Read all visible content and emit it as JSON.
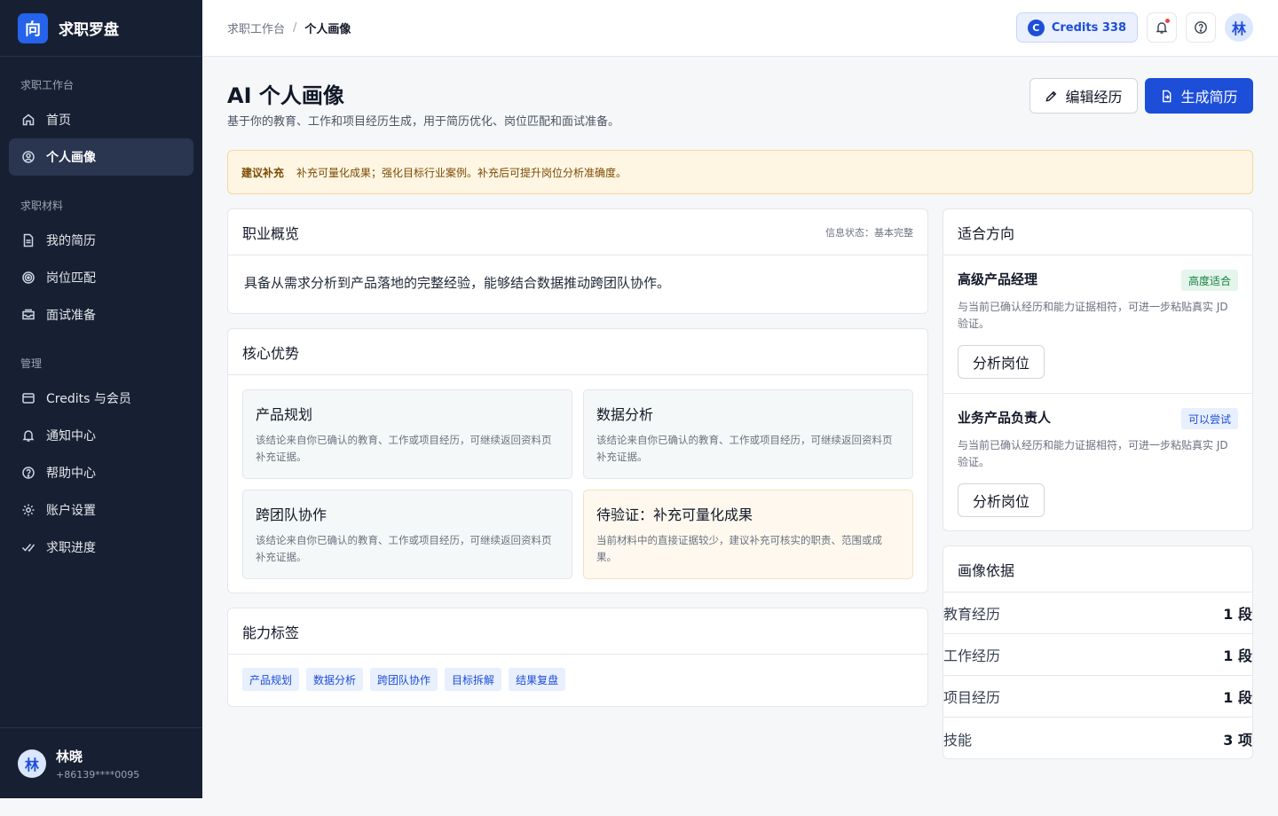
{
  "brand": {
    "logo_char": "向",
    "name": "求职罗盘"
  },
  "sidebar": {
    "sections": [
      {
        "title": "求职工作台",
        "items": [
          {
            "label": "首页",
            "icon": "home-icon"
          },
          {
            "label": "个人画像",
            "icon": "user-circle-icon",
            "active": true
          }
        ]
      },
      {
        "title": "求职材料",
        "items": [
          {
            "label": "我的简历",
            "icon": "document-icon"
          },
          {
            "label": "岗位匹配",
            "icon": "target-icon"
          },
          {
            "label": "面试准备",
            "icon": "inbox-icon"
          }
        ]
      },
      {
        "title": "管理",
        "items": [
          {
            "label": "Credits 与会员",
            "icon": "card-icon"
          },
          {
            "label": "通知中心",
            "icon": "bell-icon"
          },
          {
            "label": "帮助中心",
            "icon": "help-icon"
          },
          {
            "label": "账户设置",
            "icon": "gear-icon"
          },
          {
            "label": "求职进度",
            "icon": "check-double-icon"
          }
        ]
      }
    ]
  },
  "user": {
    "avatar_char": "林",
    "name": "林晓",
    "phone": "+86139****0095"
  },
  "header": {
    "breadcrumb": {
      "parent": "求职工作台",
      "separator": "/",
      "current": "个人画像"
    },
    "credits": {
      "icon_char": "C",
      "label": "Credits 338"
    },
    "avatar_char": "林"
  },
  "page": {
    "title": "AI 个人画像",
    "subtitle": "基于你的教育、工作和项目经历生成，用于简历优化、岗位匹配和面试准备。",
    "edit_button": "编辑经历",
    "generate_button": "生成简历"
  },
  "alert": {
    "tag": "建议补充",
    "text": "补充可量化成果；强化目标行业案例。补充后可提升岗位分析准确度。"
  },
  "overview": {
    "title": "职业概览",
    "meta": "信息状态：基本完整",
    "text": "具备从需求分析到产品落地的完整经验，能够结合数据推动跨团队协作。"
  },
  "strengths": {
    "title": "核心优势",
    "items": [
      {
        "title": "产品规划",
        "desc": "该结论来自你已确认的教育、工作或项目经历，可继续返回资料页补充证据。"
      },
      {
        "title": "数据分析",
        "desc": "该结论来自你已确认的教育、工作或项目经历，可继续返回资料页补充证据。"
      },
      {
        "title": "跨团队协作",
        "desc": "该结论来自你已确认的教育、工作或项目经历，可继续返回资料页补充证据。"
      },
      {
        "title": "待验证：补充可量化成果",
        "desc": "当前材料中的直接证据较少，建议补充可核实的职责、范围或成果。"
      }
    ]
  },
  "ability_tags": {
    "title": "能力标签",
    "items": [
      "产品规划",
      "数据分析",
      "跨团队协作",
      "目标拆解",
      "结果复盘"
    ]
  },
  "directions": {
    "title": "适合方向",
    "items": [
      {
        "name": "高级产品经理",
        "badge": "高度适合",
        "badge_color": "#15803d",
        "desc": "与当前已确认经历和能力证据相符，可进一步粘贴真实 JD 验证。",
        "button": "分析岗位"
      },
      {
        "name": "业务产品负责人",
        "badge": "可以尝试",
        "badge_color": "#1d4ed8",
        "desc": "与当前已确认经历和能力证据相符，可进一步粘贴真实 JD 验证。",
        "button": "分析岗位"
      }
    ]
  },
  "basis": {
    "title": "画像依据",
    "rows": [
      {
        "label": "教育经历",
        "value": "1 段"
      },
      {
        "label": "工作经历",
        "value": "1 段"
      },
      {
        "label": "项目经历",
        "value": "1 段"
      },
      {
        "label": "技能",
        "value": "3 项"
      }
    ]
  },
  "colors": {
    "accent": "#1d4ed8",
    "sidebar_bg": "#172033",
    "alert_bg": "#fef6e3"
  }
}
